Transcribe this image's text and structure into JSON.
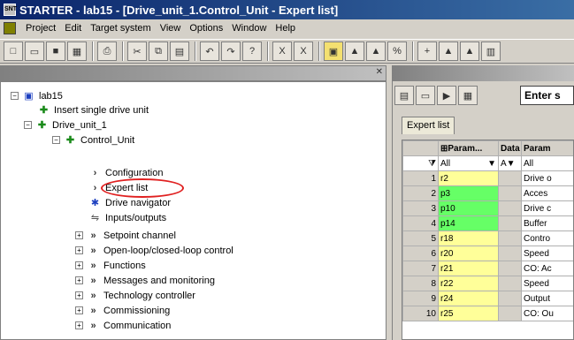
{
  "window": {
    "title": "STARTER - lab15 - [Drive_unit_1.Control_Unit - Expert list]",
    "app_icon_text": "SNT"
  },
  "menu": [
    "Project",
    "Edit",
    "Target system",
    "View",
    "Options",
    "Window",
    "Help"
  ],
  "tree": {
    "root": "lab15",
    "insert_label": "Insert single drive unit",
    "drive_unit": "Drive_unit_1",
    "control_unit": "Control_Unit",
    "cu_items": [
      "Configuration",
      "Expert list",
      "Drive navigator",
      "Inputs/outputs"
    ],
    "groups": [
      "Setpoint channel",
      "Open-loop/closed-loop control",
      "Functions",
      "Messages and monitoring",
      "Technology controller",
      "Commissioning",
      "Communication"
    ]
  },
  "right": {
    "search_placeholder": "Enter s",
    "tab_label": "Expert list",
    "columns": {
      "param": "⊞Param...",
      "data": "Data",
      "name": "Param"
    },
    "filter": {
      "param": "All",
      "data": "A",
      "name": "All"
    },
    "rows": [
      {
        "n": "1",
        "param": "r2",
        "color": "yellow",
        "name": "Drive o"
      },
      {
        "n": "2",
        "param": "p3",
        "color": "green",
        "name": "Acces"
      },
      {
        "n": "3",
        "param": "p10",
        "color": "green",
        "name": "Drive c"
      },
      {
        "n": "4",
        "param": "p14",
        "color": "green",
        "name": "Buffer"
      },
      {
        "n": "5",
        "param": "r18",
        "color": "yellow",
        "name": "Contro"
      },
      {
        "n": "6",
        "param": "r20",
        "color": "yellow",
        "name": "Speed"
      },
      {
        "n": "7",
        "param": "r21",
        "color": "yellow",
        "name": "CO: Ac"
      },
      {
        "n": "8",
        "param": "r22",
        "color": "yellow",
        "name": "Speed"
      },
      {
        "n": "9",
        "param": "r24",
        "color": "yellow",
        "name": "Output"
      },
      {
        "n": "10",
        "param": "r25",
        "color": "yellow",
        "name": "CO: Ou"
      }
    ]
  }
}
